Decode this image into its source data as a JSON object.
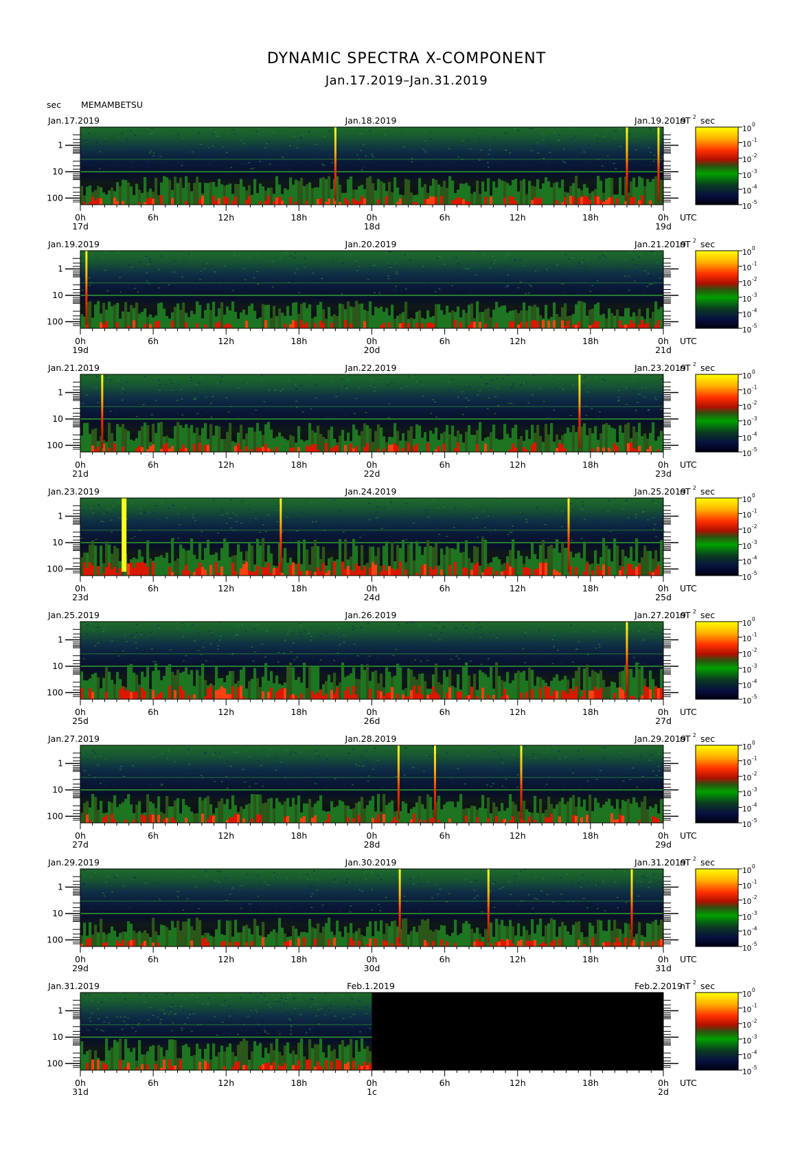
{
  "page": {
    "title": "DYNAMIC SPECTRA X-COMPONENT",
    "subtitle": "Jan.17.2019–Jan.31.2019",
    "y_unit": "sec",
    "station": "MEMAMBETSU"
  },
  "chart_data": {
    "type": "heatmap",
    "title": "DYNAMIC SPECTRA X-COMPONENT",
    "subtitle": "Jan.17.2019–Jan.31.2019",
    "ylabel": "sec",
    "y_scale": "log",
    "y_ticks": [
      "1",
      "10",
      "100"
    ],
    "x_ticks": [
      "0h",
      "6h",
      "12h",
      "18h",
      "0h",
      "6h",
      "12h",
      "18h",
      "0h"
    ],
    "x_unit": "UTC",
    "colorbar": {
      "unit_base": "nT",
      "unit_exp": "2",
      "unit_suffix": "sec",
      "ticks": [
        {
          "base": "10",
          "exp": "0"
        },
        {
          "base": "10",
          "exp": "-1"
        },
        {
          "base": "10",
          "exp": "-2"
        },
        {
          "base": "10",
          "exp": "-3"
        },
        {
          "base": "10",
          "exp": "-4"
        },
        {
          "base": "10",
          "exp": "-5"
        }
      ],
      "colors": [
        "#ffff00",
        "#ffa000",
        "#ff2000",
        "#c01000",
        "#207000",
        "#00a000",
        "#104020",
        "#080830",
        "#000000"
      ]
    },
    "panels": [
      {
        "start": "Jan.17.2019",
        "mid": "Jan.18.2019",
        "end": "Jan.19.2019",
        "d0": "17d",
        "d1": "18d",
        "d2": "19d",
        "spikes": [
          {
            "h": 21.0,
            "top": "#ffff40"
          },
          {
            "h": 45.0,
            "top": "#ffff40"
          },
          {
            "h": 47.6,
            "top": "#ffff40"
          }
        ],
        "activity": 0.35,
        "data_until": 48
      },
      {
        "start": "Jan.19.2019",
        "mid": "Jan.20.2019",
        "end": "Jan.21.2019",
        "d0": "19d",
        "d1": "20d",
        "d2": "21d",
        "spikes": [
          {
            "h": 0.5,
            "top": "#ffff40"
          }
        ],
        "activity": 0.25,
        "data_until": 48
      },
      {
        "start": "Jan.21.2019",
        "mid": "Jan.22.2019",
        "end": "Jan.23.2019",
        "d0": "21d",
        "d1": "22d",
        "d2": "23d",
        "spikes": [
          {
            "h": 1.8,
            "top": "#ffff40"
          },
          {
            "h": 41.1,
            "top": "#ffff40"
          }
        ],
        "activity": 0.4,
        "data_until": 48
      },
      {
        "start": "Jan.23.2019",
        "mid": "Jan.24.2019",
        "end": "Jan.25.2019",
        "d0": "23d",
        "d1": "24d",
        "d2": "25d",
        "spikes": [
          {
            "h": 3.6,
            "top": "#ffff40",
            "wide": true
          },
          {
            "h": 16.5,
            "top": "#ffff40"
          },
          {
            "h": 40.2,
            "top": "#ffff40"
          }
        ],
        "activity": 0.85,
        "data_until": 48
      },
      {
        "start": "Jan.25.2019",
        "mid": "Jan.26.2019",
        "end": "Jan.27.2019",
        "d0": "25d",
        "d1": "26d",
        "d2": "27d",
        "spikes": [
          {
            "h": 45.0,
            "top": "#ffff40"
          }
        ],
        "activity": 0.8,
        "data_until": 48
      },
      {
        "start": "Jan.27.2019",
        "mid": "Jan.28.2019",
        "end": "Jan.29.2019",
        "d0": "27d",
        "d1": "28d",
        "d2": "29d",
        "spikes": [
          {
            "h": 26.2,
            "top": "#ffff40"
          },
          {
            "h": 29.2,
            "top": "#ffff40"
          },
          {
            "h": 36.3,
            "top": "#ffff40"
          }
        ],
        "activity": 0.35,
        "data_until": 48
      },
      {
        "start": "Jan.29.2019",
        "mid": "Jan.30.2019",
        "end": "Jan.31.2019",
        "d0": "29d",
        "d1": "30d",
        "d2": "31d",
        "spikes": [
          {
            "h": 26.3,
            "top": "#ffff40"
          },
          {
            "h": 33.6,
            "top": "#ffff40"
          },
          {
            "h": 45.4,
            "top": "#ffff40"
          }
        ],
        "activity": 0.35,
        "data_until": 48
      },
      {
        "start": "Jan.31.2019",
        "mid": "Feb.1.2019",
        "end": "Feb.2.2019",
        "d0": "31d",
        "d1": "1c",
        "d2": "2d",
        "spikes": [],
        "activity": 0.5,
        "data_until": 24
      }
    ]
  }
}
